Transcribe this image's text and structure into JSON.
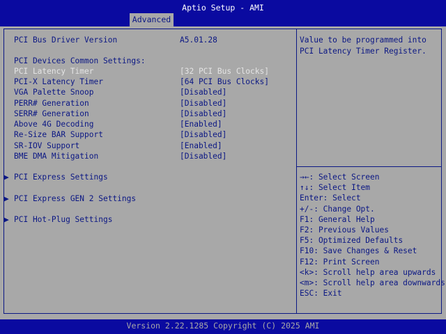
{
  "header": {
    "title": "Aptio Setup - AMI",
    "tab": "Advanced"
  },
  "info": {
    "driver_label": "PCI Bus Driver Version",
    "driver_value": "A5.01.28",
    "section_heading": "PCI Devices Common Settings:"
  },
  "settings": [
    {
      "label": "PCI Latency Timer",
      "value": "[32 PCI Bus Clocks]"
    },
    {
      "label": "PCI-X Latency Timer",
      "value": "[64 PCI Bus Clocks]"
    },
    {
      "label": "VGA Palette Snoop",
      "value": "[Disabled]"
    },
    {
      "label": "PERR# Generation",
      "value": "[Disabled]"
    },
    {
      "label": "SERR# Generation",
      "value": "[Disabled]"
    },
    {
      "label": "Above 4G Decoding",
      "value": "[Enabled]"
    },
    {
      "label": "Re-Size BAR Support",
      "value": "[Disabled]"
    },
    {
      "label": "SR-IOV Support",
      "value": "[Enabled]"
    },
    {
      "label": "BME DMA Mitigation",
      "value": "[Disabled]"
    }
  ],
  "submenus": [
    {
      "label": "PCI Express Settings"
    },
    {
      "label": "PCI Express GEN 2 Settings"
    },
    {
      "label": "PCI Hot-Plug Settings"
    }
  ],
  "submenu_arrow": "▶",
  "help": {
    "line1": "Value to be programmed into",
    "line2": "PCI Latency Timer Register."
  },
  "keys": [
    "→←: Select Screen",
    "↑↓: Select Item",
    "Enter: Select",
    "+/-: Change Opt.",
    "F1: General Help",
    "F2: Previous Values",
    "F5: Optimized Defaults",
    "F10: Save Changes & Reset",
    "F12: Print Screen",
    "<k>: Scroll help area upwards",
    "<m>: Scroll help area downwards",
    "ESC: Exit"
  ],
  "footer": {
    "version": "Version 2.22.1285 Copyright (C) 2025 AMI"
  },
  "colors": {
    "bar": "#0a0aa0",
    "background": "#a8a8a8",
    "text": "#0b1784",
    "highlight": "#e4e4e4"
  }
}
